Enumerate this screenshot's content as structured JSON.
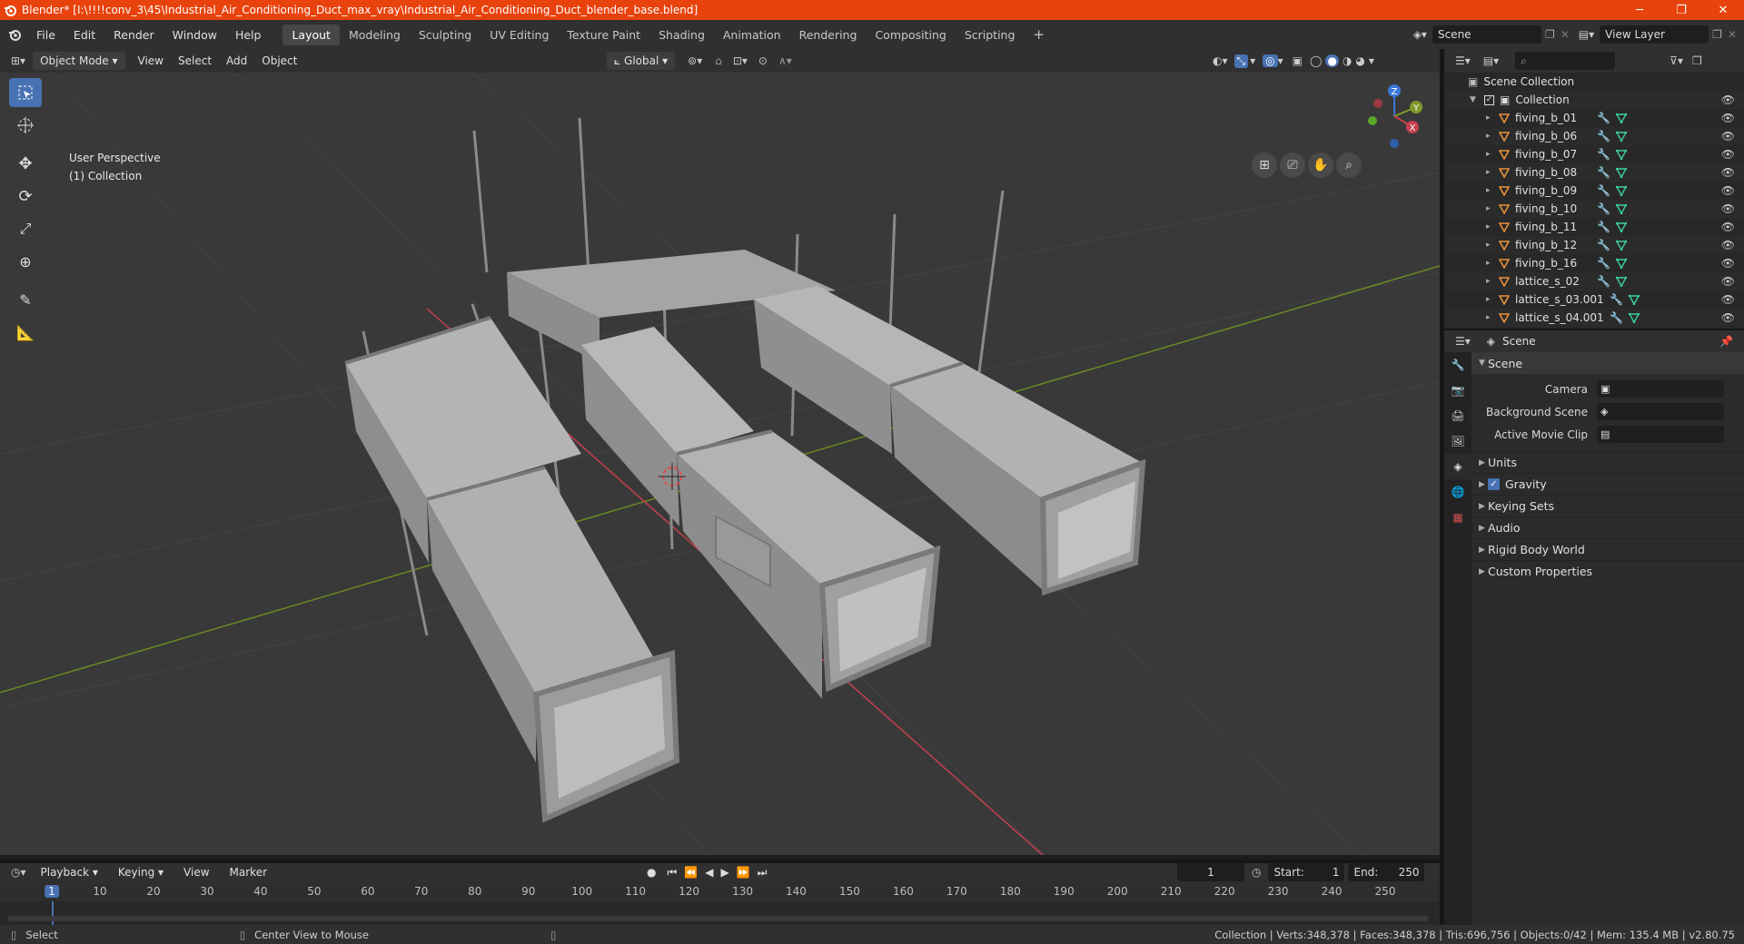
{
  "window": {
    "title": "Blender* [I:\\!!!!conv_3\\45\\Industrial_Air_Conditioning_Duct_max_vray\\Industrial_Air_Conditioning_Duct_blender_base.blend]",
    "min_glyph": "─",
    "max_glyph": "❐",
    "close_glyph": "✕"
  },
  "menu": [
    "File",
    "Edit",
    "Render",
    "Window",
    "Help"
  ],
  "workspaces": [
    "Layout",
    "Modeling",
    "Sculpting",
    "UV Editing",
    "Texture Paint",
    "Shading",
    "Animation",
    "Rendering",
    "Compositing",
    "Scripting"
  ],
  "active_workspace": "Layout",
  "scene_field": "Scene",
  "view_layer_field": "View Layer",
  "viewport_header": {
    "mode": "Object Mode",
    "menus": [
      "View",
      "Select",
      "Add",
      "Object"
    ],
    "orientation": "Global"
  },
  "viewport": {
    "perspective": "User Perspective",
    "collection": "(1) Collection",
    "gizmo": {
      "x": "X",
      "y": "Y",
      "z": "Z"
    }
  },
  "outliner": {
    "root": "Scene Collection",
    "collection": "Collection",
    "items": [
      "fiving_b_01",
      "fiving_b_06",
      "fiving_b_07",
      "fiving_b_08",
      "fiving_b_09",
      "fiving_b_10",
      "fiving_b_11",
      "fiving_b_12",
      "fiving_b_16",
      "lattice_s_02",
      "lattice_s_03.001",
      "lattice_s_04.001"
    ]
  },
  "properties": {
    "header": "Scene",
    "panel": "Scene",
    "camera_label": "Camera",
    "background_label": "Background Scene",
    "movieclip_label": "Active Movie Clip",
    "sub_panels": [
      "Units",
      "Gravity",
      "Keying Sets",
      "Audio",
      "Rigid Body World",
      "Custom Properties"
    ]
  },
  "timeline": {
    "menus": [
      "Playback",
      "Keying",
      "View",
      "Marker"
    ],
    "current_frame": "1",
    "start_label": "Start:",
    "start": "1",
    "end_label": "End:",
    "end": "250",
    "ticks": [
      "1",
      "10",
      "20",
      "30",
      "40",
      "50",
      "60",
      "70",
      "80",
      "90",
      "100",
      "110",
      "120",
      "130",
      "140",
      "150",
      "160",
      "170",
      "180",
      "190",
      "200",
      "210",
      "220",
      "230",
      "240",
      "250"
    ]
  },
  "status": {
    "left": "Select",
    "middle": "Center View to Mouse",
    "right": "Collection | Verts:348,378 | Faces:348,378 | Tris:696,756 | Objects:0/42 | Mem: 135.4 MB | v2.80.75"
  },
  "colors": {
    "accent": "#4772b3",
    "title_bar": "#e8420d",
    "x_axis": "#c6404f",
    "y_axis": "#7e9a2a",
    "z_axis": "#3b78d8"
  }
}
